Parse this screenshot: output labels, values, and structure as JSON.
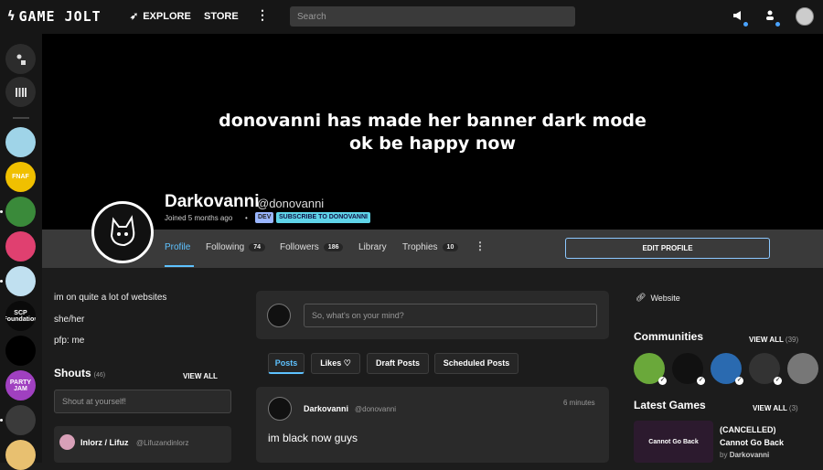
{
  "topbar": {
    "logo": "GAME JOLT",
    "explore": "EXPLORE",
    "store": "STORE",
    "more_icon": "⋮",
    "search_placeholder": "Search"
  },
  "sidebar": {
    "games": [
      {
        "label": "",
        "bg": "#9fd4e8"
      },
      {
        "label": "FNAF",
        "bg": "#f0c000"
      },
      {
        "label": "",
        "bg": "#3a8a3a"
      },
      {
        "label": "",
        "bg": "#e04070"
      },
      {
        "label": "",
        "bg": "#c0e0f0"
      },
      {
        "label": "SCP Foundation",
        "bg": "#0a0a0a"
      },
      {
        "label": "",
        "bg": "#000000"
      },
      {
        "label": "PARTY JAM",
        "bg": "#a040c0"
      },
      {
        "label": "",
        "bg": "#3a3a3a"
      },
      {
        "label": "",
        "bg": "#e8c070"
      }
    ]
  },
  "banner": {
    "line1": "donovanni has made her banner dark mode",
    "line2": "ok be happy now"
  },
  "profile": {
    "display_name": "Darkovanni",
    "handle": "@donovanni",
    "joined": "Joined 5 months ago",
    "badge_dev": "DEV",
    "badge_subscribe": "SUBSCRIBE TO DONOVANNI",
    "tabs": [
      {
        "label": "Profile",
        "count": null
      },
      {
        "label": "Following",
        "count": "74"
      },
      {
        "label": "Followers",
        "count": "186"
      },
      {
        "label": "Library",
        "count": null
      },
      {
        "label": "Trophies",
        "count": "10"
      }
    ],
    "edit_button": "EDIT PROFILE"
  },
  "bio": {
    "line1": "im on quite a lot of websites",
    "line2": "she/her",
    "line3": "pfp: me"
  },
  "shouts": {
    "title": "Shouts",
    "count": "(46)",
    "view_all": "VIEW ALL",
    "input_placeholder": "Shout at yourself!",
    "first": {
      "name": "Inlorz / Lifuz",
      "handle": "@Lifuzandinlorz"
    }
  },
  "composer": {
    "placeholder": "So, what's on your mind?"
  },
  "feed_tabs": {
    "posts": "Posts",
    "likes": "Likes",
    "drafts": "Draft Posts",
    "scheduled": "Scheduled Posts"
  },
  "post": {
    "name": "Darkovanni",
    "handle": "@donovanni",
    "time": "6 minutes",
    "body": "im black now guys"
  },
  "right": {
    "website": "Website",
    "communities_title": "Communities",
    "communities_view_all": "VIEW ALL",
    "communities_count": "(39)",
    "latest_games_title": "Latest Games",
    "latest_games_view_all": "VIEW ALL",
    "latest_games_count": "(3)",
    "game": {
      "thumb_text": "Cannot Go Back",
      "title_line1": "(CANCELLED)",
      "title_line2": "Cannot Go Back",
      "by_prefix": "by",
      "author": "Darkovanni"
    }
  },
  "colors": {
    "accent": "#5ec2ff",
    "background": "#1c1c1c",
    "topbar": "#161616",
    "card": "#2a2a2a"
  }
}
